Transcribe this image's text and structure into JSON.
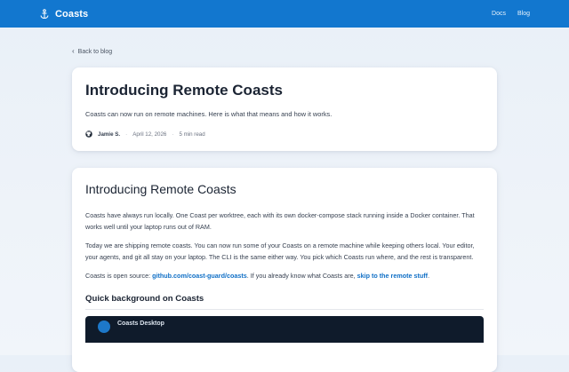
{
  "header": {
    "brand": "Coasts",
    "nav": [
      "Docs",
      "Blog"
    ],
    "accent": "#1277cf"
  },
  "back_link": "Back to blog",
  "hero": {
    "title": "Introducing Remote Coasts",
    "subtitle": "Coasts can now run on remote machines. Here is what that means and how it works.",
    "author": "Jamie S.",
    "date": "April 12, 2026",
    "read_time": "5 min read"
  },
  "article": {
    "heading": "Introducing Remote Coasts",
    "p1": "Coasts have always run locally. One Coast per worktree, each with its own docker-compose stack running inside a Docker container. That works well until your laptop runs out of RAM.",
    "p2": "Today we are shipping remote coasts. You can now run some of your Coasts on a remote machine while keeping others local. Your editor, your agents, and git all stay on your laptop. The CLI is the same either way. You pick which Coasts run where, and the rest is transparent.",
    "p3_prefix": "Coasts is open source: ",
    "p3_link1": "github.com/coast-guard/coasts",
    "p3_middle": ". If you already know what Coasts are, ",
    "p3_link2": "skip to the remote stuff",
    "p3_suffix": ".",
    "section_heading": "Quick background on Coasts",
    "panel_title": "Coasts Desktop"
  }
}
